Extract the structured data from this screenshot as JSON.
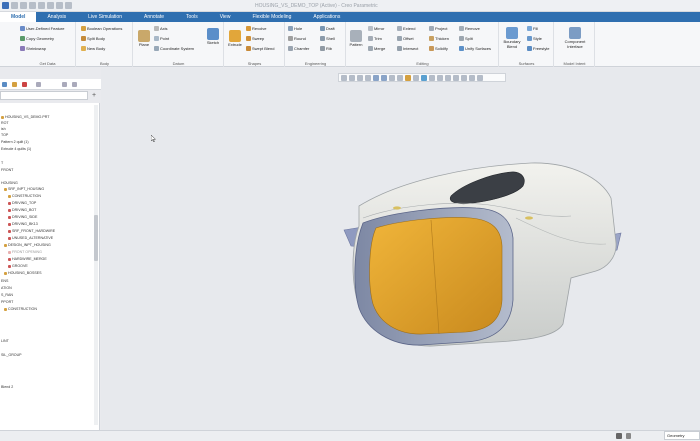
{
  "window": {
    "title": "HOUSING_VS_DEMO_TOP (Active) - Creo Parametric"
  },
  "ribbon_tabs": [
    "Model",
    "Analysis",
    "Live Simulation",
    "Annotate",
    "Tools",
    "View",
    "Flexible Modeling",
    "Applications"
  ],
  "get_data": {
    "items": [
      "User-Defined Feature",
      "Copy Geometry",
      "Shrinkwrap"
    ],
    "label": "Get Data"
  },
  "body_group": {
    "items": [
      "Boolean Operations",
      "Split Body",
      "New Body"
    ],
    "label": "Body"
  },
  "datum": {
    "plane": "Plane",
    "items": [
      "Axis",
      "Point",
      "Coordinate System"
    ],
    "sketch": "Sketch",
    "label": "Datum"
  },
  "shapes": {
    "extrude": "Extrude",
    "items": [
      "Revolve",
      "Sweep",
      "Swept Blend"
    ],
    "label": "Shapes"
  },
  "engineering": {
    "col1": [
      "Hole",
      "Round",
      "Chamfer"
    ],
    "col2": [
      "Draft",
      "Shell",
      "Rib"
    ],
    "label": "Engineering"
  },
  "editing": {
    "pattern": "Pattern",
    "col1": [
      "Mirror",
      "Trim",
      "Merge"
    ],
    "col2": [
      "Extend",
      "Offset",
      "Intersect"
    ],
    "col3": [
      "Project",
      "Thicken",
      "Solidify"
    ],
    "col4": [
      "Remove",
      "Split",
      "Unify Surfaces"
    ],
    "label": "Editing"
  },
  "surfaces": {
    "boundary_blend": "Boundary Blend",
    "items": [
      "Fill",
      "Style",
      "Freestyle"
    ],
    "label": "Surfaces"
  },
  "model_intent": {
    "component_interface": "Component Interface",
    "label": "Model Intent"
  },
  "tree": {
    "items": [
      "HOUSING_VS_DEMO.PRT",
      "ROT",
      "ish",
      "TOP",
      "Pattern 2 quilt (1)",
      "Extrude 4 quilts (1)",
      "T",
      "FRONT",
      "HOUSING",
      "SRF_INPT_HOUSING",
      "CONSTRUCTION",
      "DRIVING_TOP",
      "DRIVING_BOT",
      "DRIVING_SIDE",
      "DRIVING_BK13",
      "SRF_FRONT_HARDWIRE",
      "UNUSED_ALTERNATIVE",
      "DESIGN_INPT_HOUSING",
      "FRONT OPENING",
      "HARDWIRE_MERGE",
      "GROOVE",
      "HOUSING_BOSSES",
      "ENS",
      "ATION",
      "S_RAN",
      "PPORT",
      "CONSTRUCTION",
      "LINT",
      "SIL_GROUP",
      "Blend 2"
    ]
  },
  "status": {
    "filter": "Geometry"
  },
  "colors": {
    "ribbon_blue": "#2f6fb0",
    "housing_gray": "#dcdedd",
    "opening_orange": "#e4a329",
    "band_blue": "#8d98b2"
  }
}
